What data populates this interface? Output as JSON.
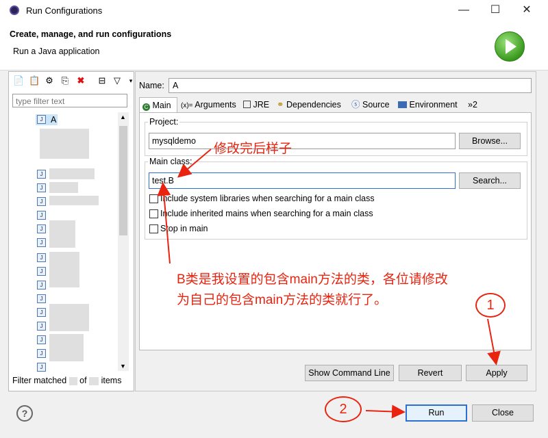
{
  "window": {
    "title": "Run Configurations",
    "minimize": "—",
    "maximize": "☐",
    "close": "✕"
  },
  "header": {
    "title": "Create, manage, and run configurations",
    "subtitle": "Run a Java application",
    "icon": "run-icon"
  },
  "left": {
    "filter_placeholder": "type filter text",
    "selected_item": "A",
    "filter_matched_prefix": "Filter matched",
    "filter_matched_of": "of",
    "filter_matched_suffix": "items"
  },
  "config": {
    "name_label": "Name:",
    "name_value": "A",
    "tabs": [
      "Main",
      "Arguments",
      "JRE",
      "Dependencies",
      "Source",
      "Environment",
      "»2"
    ],
    "project_label": "Project:",
    "project_value": "mysqldemo",
    "browse_label": "Browse...",
    "main_class_label": "Main class:",
    "main_class_value": "test.B",
    "search_label": "Search...",
    "checks": [
      "Include system libraries when searching for a main class",
      "Include inherited mains when searching for a main class",
      "Stop in main"
    ],
    "show_command_line": "Show Command Line",
    "revert": "Revert",
    "apply": "Apply"
  },
  "footer": {
    "run": "Run",
    "close": "Close",
    "help": "?"
  },
  "annotations": {
    "modified_note": "修改完后样子",
    "explain_line1": "B类是我设置的包含main方法的类，各位请修改",
    "explain_line2": "为自己的包含main方法的类就行了。",
    "step1": "1",
    "step2": "2"
  },
  "colors": {
    "annotation": "#e8230f",
    "focus": "#2b6fd4"
  }
}
